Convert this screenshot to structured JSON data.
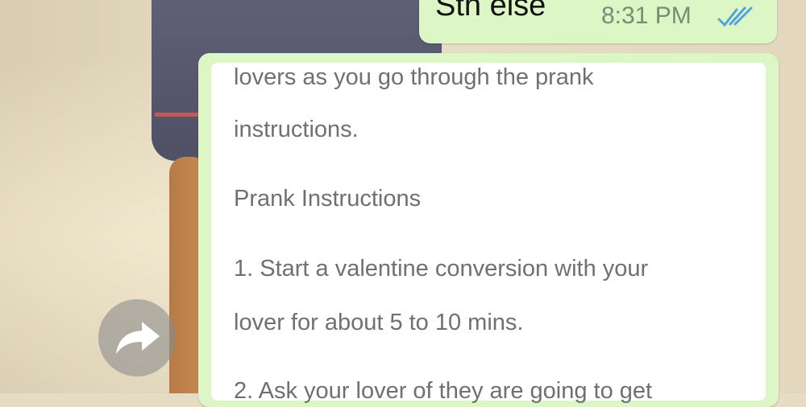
{
  "sent_message": {
    "text": "Sth else",
    "time": "8:31 PM",
    "status_icon": "double-check-icon"
  },
  "received_message": {
    "lines": [
      "lovers as you go through the prank",
      "instructions.",
      "Prank Instructions",
      "1. Start a valentine conversion with your",
      "lover for about 5 to 10 mins.",
      "2. Ask your lover of they are going to get"
    ]
  },
  "forward_button": {
    "icon": "forward-arrow-icon"
  },
  "colors": {
    "bubble_green": "#dcf6c5",
    "read_tick_blue": "#4fa3e0",
    "text_gray": "#707070"
  }
}
